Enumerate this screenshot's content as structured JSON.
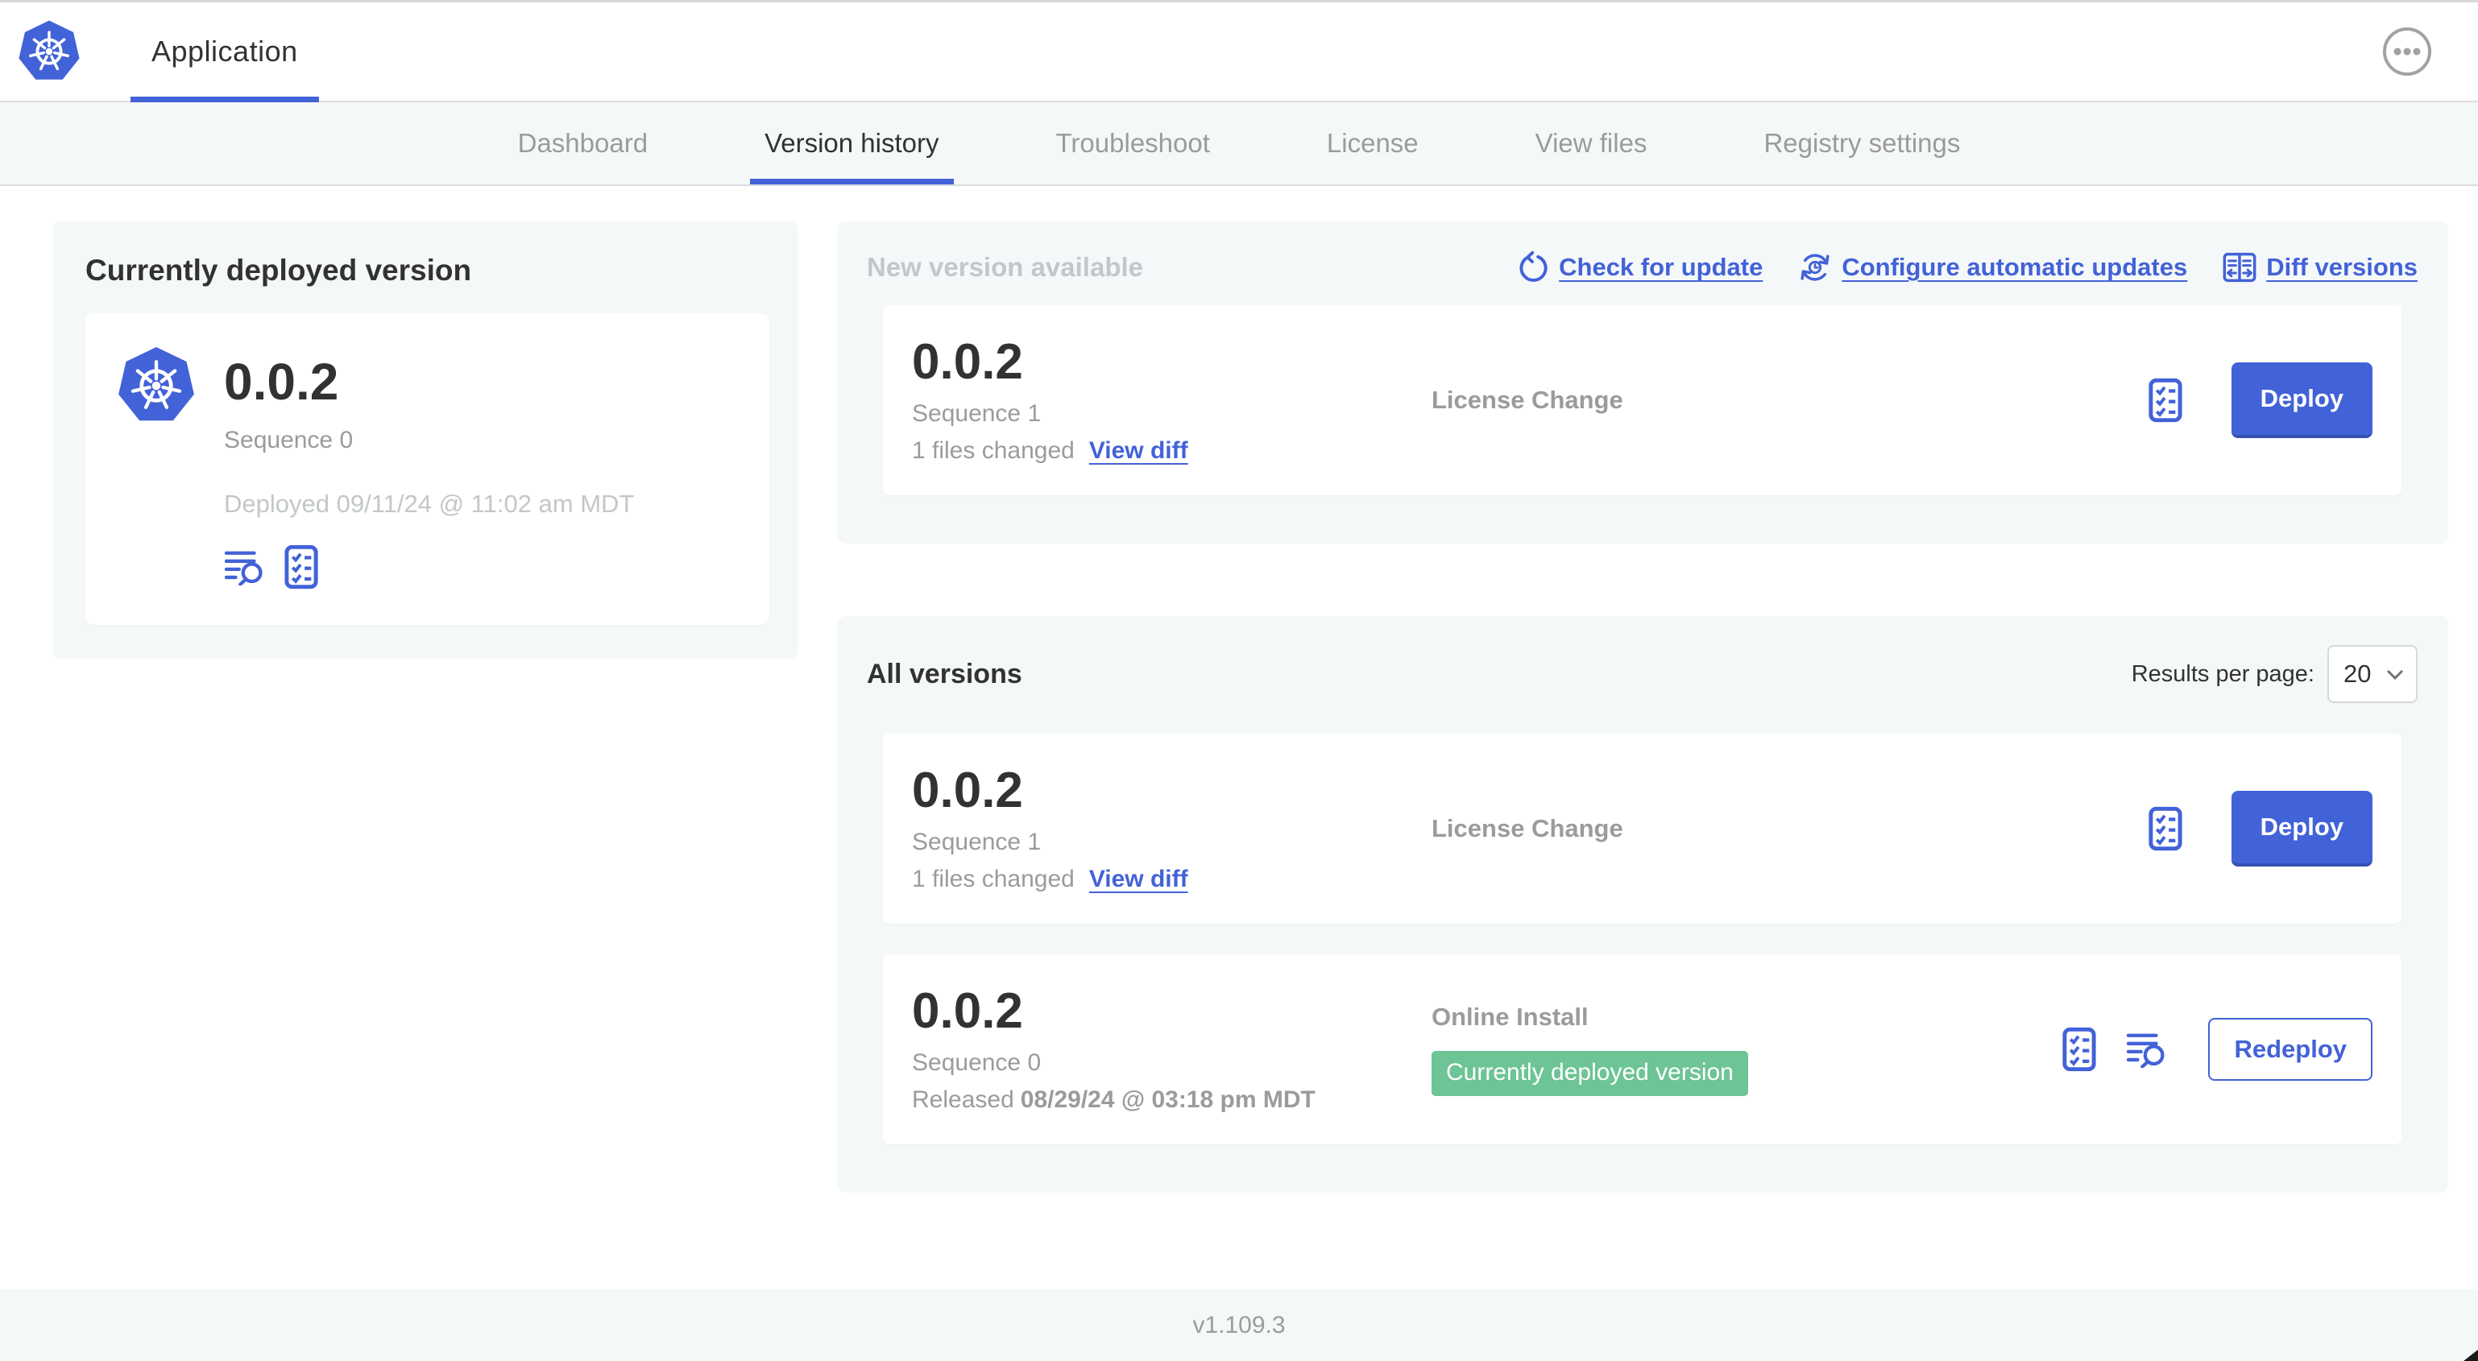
{
  "app": {
    "title": "Application"
  },
  "nav": {
    "tabs": [
      "Dashboard",
      "Version history",
      "Troubleshoot",
      "License",
      "View files",
      "Registry settings"
    ],
    "active_tab": "Version history"
  },
  "current": {
    "heading": "Currently deployed version",
    "version": "0.0.2",
    "sequence": "Sequence 0",
    "deployed": "Deployed 09/11/24 @ 11:02 am MDT"
  },
  "new_version": {
    "heading": "New version available",
    "check_for_update": "Check for update",
    "configure_updates": "Configure automatic updates",
    "diff_versions": "Diff versions",
    "row": {
      "version": "0.0.2",
      "sequence": "Sequence 1",
      "files_changed": "1 files changed",
      "view_diff": "View diff",
      "source": "License Change",
      "deploy": "Deploy"
    }
  },
  "all_versions": {
    "heading": "All versions",
    "results_per_page_label": "Results per page:",
    "results_per_page": "20",
    "rows": [
      {
        "version": "0.0.2",
        "sequence": "Sequence 1",
        "files_changed": "1 files changed",
        "view_diff": "View diff",
        "source": "License Change",
        "action": "Deploy"
      },
      {
        "version": "0.0.2",
        "sequence": "Sequence 0",
        "released_label": "Released",
        "released_date": "08/29/24 @ 03:18 pm MDT",
        "source": "Online Install",
        "badge": "Currently deployed version",
        "action": "Redeploy"
      }
    ]
  },
  "footer": {
    "version": "v1.109.3"
  },
  "icons": {
    "app_logo": "kubernetes-logo",
    "menu": "ellipsis-icon",
    "check_update": "refresh-icon",
    "auto_update": "auto-update-clock-icon",
    "diff": "diff-columns-icon",
    "logs": "view-logs-icon",
    "preflight": "checklist-icon",
    "select": "chevron-down-icon"
  },
  "colors": {
    "accent_blue": "#4262d8",
    "badge_green": "#6dc494",
    "text_dark": "#323232",
    "text_gray": "#9b9b9b",
    "text_light": "#c3c7ca",
    "section_bg": "#f5f8f9"
  }
}
